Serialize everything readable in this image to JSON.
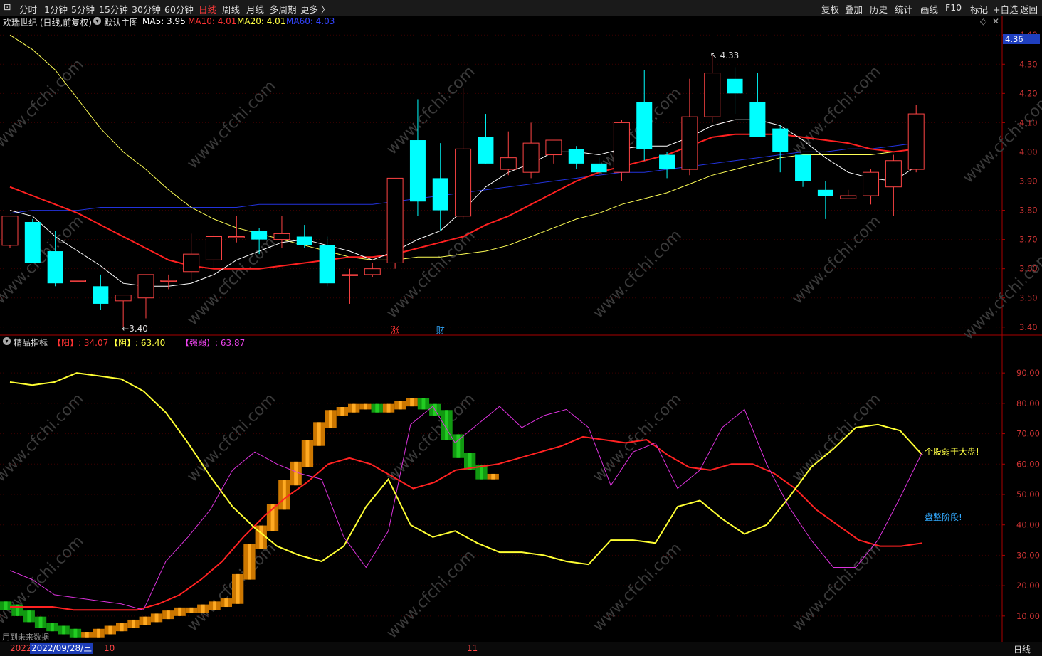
{
  "toolbar": {
    "left_items": [
      "分时",
      "1分钟",
      "5分钟",
      "15分钟",
      "30分钟",
      "60分钟",
      "日线",
      "周线",
      "月线",
      "多周期",
      "更多 〉"
    ],
    "active_item": "日线",
    "right_items": [
      "复权",
      "叠加",
      "历史",
      "统计",
      "画线",
      "F10",
      "标记",
      "+自选",
      "返回"
    ]
  },
  "main_panel": {
    "title": "欢瑞世纪 (日线,前复权)",
    "template": "默认主图",
    "ma5": "MA5: 3.95",
    "ma10": "MA10: 4.01",
    "ma20": "MA20: 4.01",
    "ma60": "MA60: 4.03",
    "current_price_tag": "4.36",
    "high_label": "4.33",
    "low_label": "3.40",
    "event_marks": [
      "涨",
      "财"
    ],
    "y_ticks": [
      "4.40",
      "4.30",
      "4.20",
      "4.10",
      "4.00",
      "3.90",
      "3.80",
      "3.70",
      "3.60",
      "3.50",
      "3.40"
    ]
  },
  "sub_panel": {
    "title": "精品指标",
    "yang": "【阳】: 34.07",
    "yin": "【阴】: 63.40",
    "strength": "【强弱】: 63.87",
    "note_weak": "个股弱于大盘!",
    "note_consolidation": "盘整阶段!",
    "y_ticks": [
      "90.00",
      "80.00",
      "70.00",
      "60.00",
      "50.00",
      "40.00",
      "30.00",
      "20.00",
      "10.00"
    ]
  },
  "footer": {
    "future_data": "用到未来数据",
    "year": "2022",
    "cursor_date": "2022/09/28/三",
    "month_10": "10",
    "month_11": "11",
    "period": "日线"
  },
  "watermark": "www.cfchi.com",
  "chart_data": [
    {
      "type": "candlestick",
      "ylim": [
        3.38,
        4.42
      ],
      "candles": [
        {
          "o": 3.68,
          "h": 3.78,
          "l": 3.67,
          "c": 3.78
        },
        {
          "o": 3.76,
          "h": 3.77,
          "l": 3.62,
          "c": 3.62
        },
        {
          "o": 3.66,
          "h": 3.73,
          "l": 3.54,
          "c": 3.55
        },
        {
          "o": 3.56,
          "h": 3.6,
          "l": 3.54,
          "c": 3.56
        },
        {
          "o": 3.54,
          "h": 3.58,
          "l": 3.46,
          "c": 3.48
        },
        {
          "o": 3.49,
          "h": 3.51,
          "l": 3.4,
          "c": 3.51
        },
        {
          "o": 3.5,
          "h": 3.58,
          "l": 3.43,
          "c": 3.58
        },
        {
          "o": 3.56,
          "h": 3.58,
          "l": 3.53,
          "c": 3.56
        },
        {
          "o": 3.59,
          "h": 3.72,
          "l": 3.56,
          "c": 3.65
        },
        {
          "o": 3.63,
          "h": 3.72,
          "l": 3.57,
          "c": 3.71
        },
        {
          "o": 3.71,
          "h": 3.78,
          "l": 3.69,
          "c": 3.71
        },
        {
          "o": 3.73,
          "h": 3.74,
          "l": 3.65,
          "c": 3.7
        },
        {
          "o": 3.7,
          "h": 3.78,
          "l": 3.67,
          "c": 3.72
        },
        {
          "o": 3.71,
          "h": 3.75,
          "l": 3.67,
          "c": 3.68
        },
        {
          "o": 3.68,
          "h": 3.71,
          "l": 3.54,
          "c": 3.55
        },
        {
          "o": 3.58,
          "h": 3.6,
          "l": 3.48,
          "c": 3.58
        },
        {
          "o": 3.58,
          "h": 3.62,
          "l": 3.57,
          "c": 3.6
        },
        {
          "o": 3.62,
          "h": 3.91,
          "l": 3.6,
          "c": 3.91
        },
        {
          "o": 4.04,
          "h": 4.18,
          "l": 3.78,
          "c": 3.83
        },
        {
          "o": 3.91,
          "h": 4.03,
          "l": 3.73,
          "c": 3.8
        },
        {
          "o": 3.78,
          "h": 4.22,
          "l": 3.77,
          "c": 4.01
        },
        {
          "o": 4.05,
          "h": 4.13,
          "l": 3.96,
          "c": 3.96
        },
        {
          "o": 3.94,
          "h": 4.07,
          "l": 3.92,
          "c": 3.98
        },
        {
          "o": 3.93,
          "h": 4.1,
          "l": 3.91,
          "c": 4.03
        },
        {
          "o": 3.99,
          "h": 4.04,
          "l": 3.96,
          "c": 4.04
        },
        {
          "o": 4.01,
          "h": 4.02,
          "l": 3.94,
          "c": 3.96
        },
        {
          "o": 3.96,
          "h": 3.98,
          "l": 3.92,
          "c": 3.93
        },
        {
          "o": 3.93,
          "h": 4.11,
          "l": 3.9,
          "c": 4.1
        },
        {
          "o": 4.17,
          "h": 4.28,
          "l": 3.97,
          "c": 4.01
        },
        {
          "o": 3.99,
          "h": 4.0,
          "l": 3.91,
          "c": 3.94
        },
        {
          "o": 3.94,
          "h": 4.25,
          "l": 3.92,
          "c": 4.12
        },
        {
          "o": 4.12,
          "h": 4.33,
          "l": 4.1,
          "c": 4.27
        },
        {
          "o": 4.25,
          "h": 4.29,
          "l": 4.13,
          "c": 4.2
        },
        {
          "o": 4.17,
          "h": 4.27,
          "l": 4.05,
          "c": 4.05
        },
        {
          "o": 4.08,
          "h": 4.09,
          "l": 3.93,
          "c": 4.0
        },
        {
          "o": 3.99,
          "h": 3.99,
          "l": 3.88,
          "c": 3.9
        },
        {
          "o": 3.87,
          "h": 3.9,
          "l": 3.77,
          "c": 3.85
        },
        {
          "o": 3.84,
          "h": 3.87,
          "l": 3.84,
          "c": 3.85
        },
        {
          "o": 3.85,
          "h": 3.94,
          "l": 3.82,
          "c": 3.93
        },
        {
          "o": 3.88,
          "h": 3.99,
          "l": 3.78,
          "c": 3.97
        },
        {
          "o": 3.94,
          "h": 4.16,
          "l": 3.93,
          "c": 4.13
        }
      ],
      "ma5": [
        3.8,
        3.78,
        3.71,
        3.66,
        3.61,
        3.55,
        3.54,
        3.54,
        3.55,
        3.58,
        3.63,
        3.66,
        3.69,
        3.7,
        3.68,
        3.66,
        3.63,
        3.66,
        3.7,
        3.73,
        3.8,
        3.88,
        3.93,
        3.96,
        4.0,
        4.0,
        3.99,
        4.01,
        4.02,
        4.02,
        4.05,
        4.09,
        4.11,
        4.11,
        4.09,
        4.04,
        3.98,
        3.93,
        3.91,
        3.9,
        3.95
      ],
      "ma10": [
        3.88,
        3.85,
        3.82,
        3.79,
        3.75,
        3.71,
        3.67,
        3.63,
        3.61,
        3.6,
        3.6,
        3.6,
        3.61,
        3.62,
        3.63,
        3.64,
        3.64,
        3.65,
        3.67,
        3.69,
        3.71,
        3.75,
        3.78,
        3.82,
        3.86,
        3.9,
        3.93,
        3.95,
        3.97,
        3.99,
        4.02,
        4.05,
        4.06,
        4.06,
        4.06,
        4.05,
        4.04,
        4.03,
        4.01,
        4.0,
        4.01
      ],
      "ma20": [
        4.4,
        4.35,
        4.28,
        4.18,
        4.08,
        4.0,
        3.94,
        3.87,
        3.81,
        3.77,
        3.74,
        3.72,
        3.7,
        3.68,
        3.66,
        3.64,
        3.63,
        3.63,
        3.64,
        3.64,
        3.65,
        3.66,
        3.68,
        3.71,
        3.74,
        3.77,
        3.79,
        3.82,
        3.84,
        3.86,
        3.89,
        3.92,
        3.94,
        3.96,
        3.98,
        3.99,
        3.99,
        3.99,
        3.99,
        4.0,
        4.01
      ],
      "ma60": [
        3.79,
        3.8,
        3.8,
        3.8,
        3.81,
        3.81,
        3.81,
        3.81,
        3.81,
        3.81,
        3.81,
        3.82,
        3.82,
        3.82,
        3.82,
        3.82,
        3.82,
        3.83,
        3.84,
        3.85,
        3.86,
        3.87,
        3.88,
        3.89,
        3.9,
        3.91,
        3.92,
        3.93,
        3.93,
        3.94,
        3.95,
        3.96,
        3.97,
        3.98,
        3.99,
        4.0,
        4.0,
        4.01,
        4.01,
        4.02,
        4.03
      ]
    },
    {
      "type": "line",
      "ylim": [
        2,
        98
      ],
      "x_count": 40,
      "series": [
        {
          "name": "【阳】",
          "color": "#ff2222",
          "values": [
            13,
            13,
            13,
            12,
            12,
            12,
            12,
            14,
            17,
            22,
            28,
            36,
            43,
            49,
            54,
            60,
            62,
            60,
            56,
            52,
            54,
            58,
            59,
            60,
            62,
            64,
            66,
            69,
            68,
            67,
            68,
            63,
            59,
            58,
            60,
            60,
            57,
            52,
            45,
            40,
            35,
            33,
            33,
            34
          ]
        },
        {
          "name": "【阴】",
          "color": "#ffff33",
          "values": [
            87,
            86,
            87,
            90,
            89,
            88,
            84,
            77,
            67,
            56,
            46,
            39,
            33,
            30,
            28,
            33,
            46,
            55,
            40,
            36,
            38,
            34,
            31,
            31,
            30,
            28,
            27,
            35,
            35,
            34,
            46,
            48,
            42,
            37,
            40,
            49,
            59,
            65,
            72,
            73,
            71,
            63
          ]
        },
        {
          "name": "【强弱】",
          "color": "#dd33dd",
          "values": [
            25,
            22,
            17,
            16,
            15,
            14,
            12,
            28,
            36,
            45,
            58,
            64,
            60,
            57,
            55,
            36,
            26,
            38,
            73,
            79,
            67,
            73,
            79,
            72,
            76,
            78,
            72,
            53,
            64,
            67,
            52,
            58,
            72,
            78,
            60,
            46,
            35,
            26,
            26,
            35,
            49,
            64
          ]
        }
      ]
    }
  ]
}
